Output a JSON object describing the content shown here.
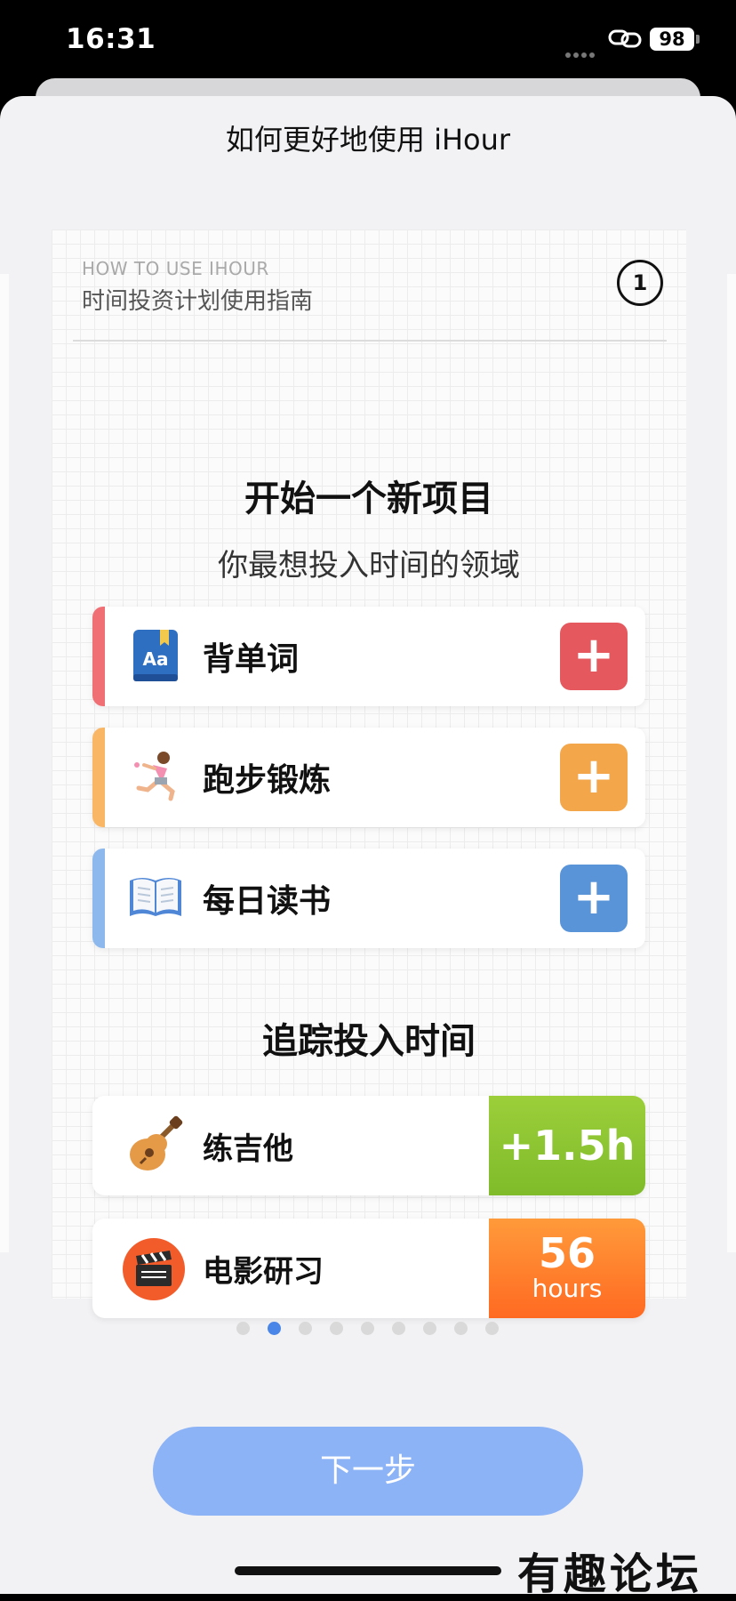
{
  "status_bar": {
    "time": "16:31",
    "battery": "98"
  },
  "sheet": {
    "title": "如何更好地使用 iHour"
  },
  "card": {
    "kicker": "HOW TO USE IHOUR",
    "subtitle": "时间投资计划使用指南",
    "step": "1",
    "section1": {
      "title": "开始一个新项目",
      "subtitle": "你最想投入时间的领域"
    },
    "projects": [
      {
        "label": "背单词",
        "icon": "vocabulary-book-icon",
        "color": "#e4585e"
      },
      {
        "label": "跑步锻炼",
        "icon": "runner-icon",
        "color": "#f3a64a"
      },
      {
        "label": "每日读书",
        "icon": "open-book-icon",
        "color": "#5a94d8"
      }
    ],
    "section2": {
      "title": "追踪投入时间"
    },
    "tracked": [
      {
        "label": "练吉他",
        "icon": "guitar-icon",
        "value": "+1.5h",
        "color": "#8cc63f"
      },
      {
        "label": "电影研习",
        "icon": "clapperboard-icon",
        "value": "56",
        "unit": "hours",
        "color": "#ff7a2e"
      }
    ]
  },
  "pager": {
    "total": 9,
    "active": 1
  },
  "actions": {
    "next_label": "下一步"
  },
  "watermark": "有趣论坛"
}
